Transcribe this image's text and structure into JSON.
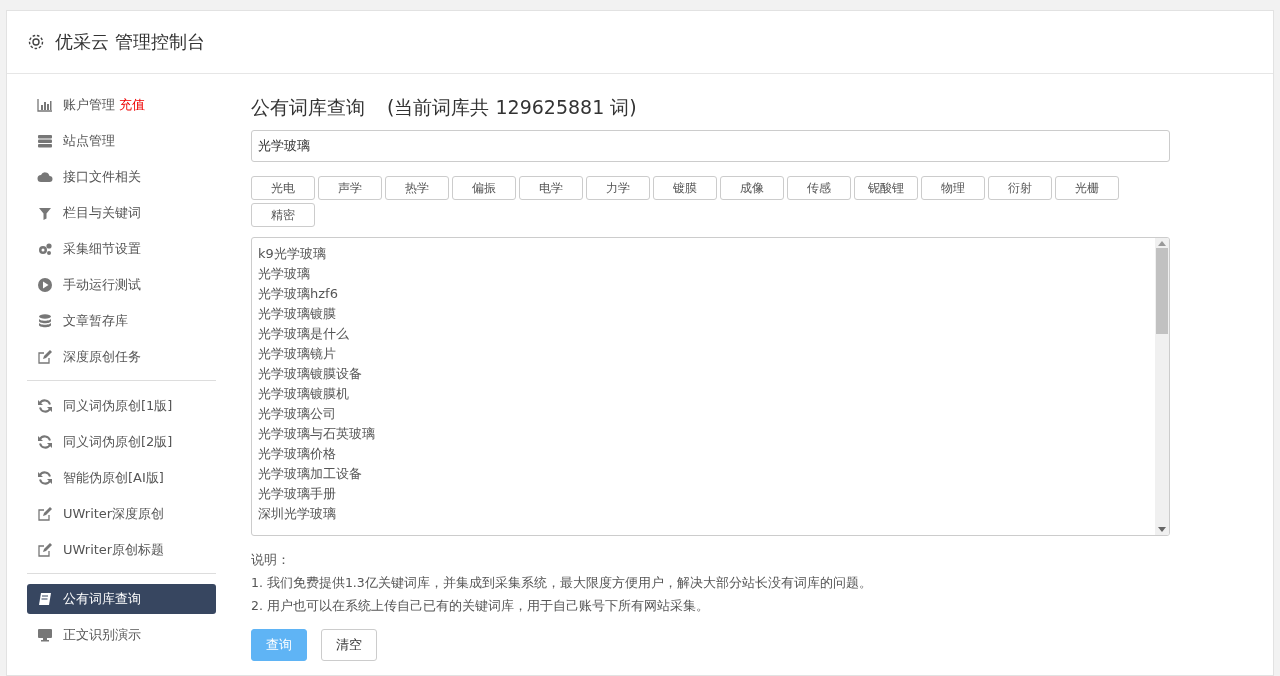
{
  "header": {
    "title": "优采云 管理控制台"
  },
  "sidebar": {
    "groups": [
      {
        "items": [
          {
            "label": "账户管理",
            "badge": "充值",
            "kind": "chart",
            "selected": false
          },
          {
            "label": "站点管理",
            "kind": "server",
            "selected": false
          },
          {
            "label": "接口文件相关",
            "kind": "cloud",
            "selected": false
          },
          {
            "label": "栏目与关键词",
            "kind": "filter",
            "selected": false
          },
          {
            "label": "采集细节设置",
            "kind": "gears",
            "selected": false
          },
          {
            "label": "手动运行测试",
            "kind": "play",
            "selected": false
          },
          {
            "label": "文章暂存库",
            "kind": "database",
            "selected": false
          },
          {
            "label": "深度原创任务",
            "kind": "edit",
            "selected": false
          }
        ]
      },
      {
        "items": [
          {
            "label": "同义词伪原创[1版]",
            "kind": "refresh",
            "selected": false
          },
          {
            "label": "同义词伪原创[2版]",
            "kind": "refresh",
            "selected": false
          },
          {
            "label": "智能伪原创[AI版]",
            "kind": "refresh",
            "selected": false
          },
          {
            "label": "UWriter深度原创",
            "kind": "edit",
            "selected": false
          },
          {
            "label": "UWriter原创标题",
            "kind": "edit",
            "selected": false
          }
        ]
      },
      {
        "items": [
          {
            "label": "公有词库查询",
            "kind": "book",
            "selected": true
          },
          {
            "label": "正文识别演示",
            "kind": "monitor",
            "selected": false
          }
        ]
      }
    ]
  },
  "main": {
    "title": "公有词库查询",
    "count_note": "(当前词库共 129625881 词)",
    "search": {
      "value": "光学玻璃"
    },
    "tags": [
      "光电",
      "声学",
      "热学",
      "偏振",
      "电学",
      "力学",
      "镀膜",
      "成像",
      "传感",
      "铌酸锂",
      "物理",
      "衍射",
      "光栅",
      "精密"
    ],
    "results": [
      "k9光学玻璃",
      "光学玻璃",
      "光学玻璃hzf6",
      "光学玻璃镀膜",
      "光学玻璃是什么",
      "光学玻璃镜片",
      "光学玻璃镀膜设备",
      "光学玻璃镀膜机",
      "光学玻璃公司",
      "光学玻璃与石英玻璃",
      "光学玻璃价格",
      "光学玻璃加工设备",
      "光学玻璃手册",
      "深圳光学玻璃"
    ],
    "notes": [
      "说明：",
      "1. 我们免费提供1.3亿关键词库，并集成到采集系统，最大限度方便用户，解决大部分站长没有词库的问题。",
      "2. 用户也可以在系统上传自己已有的关键词库，用于自己账号下所有网站采集。"
    ],
    "buttons": [
      {
        "label": "查询",
        "kind": "primary"
      },
      {
        "label": "清空",
        "kind": "default"
      }
    ]
  }
}
